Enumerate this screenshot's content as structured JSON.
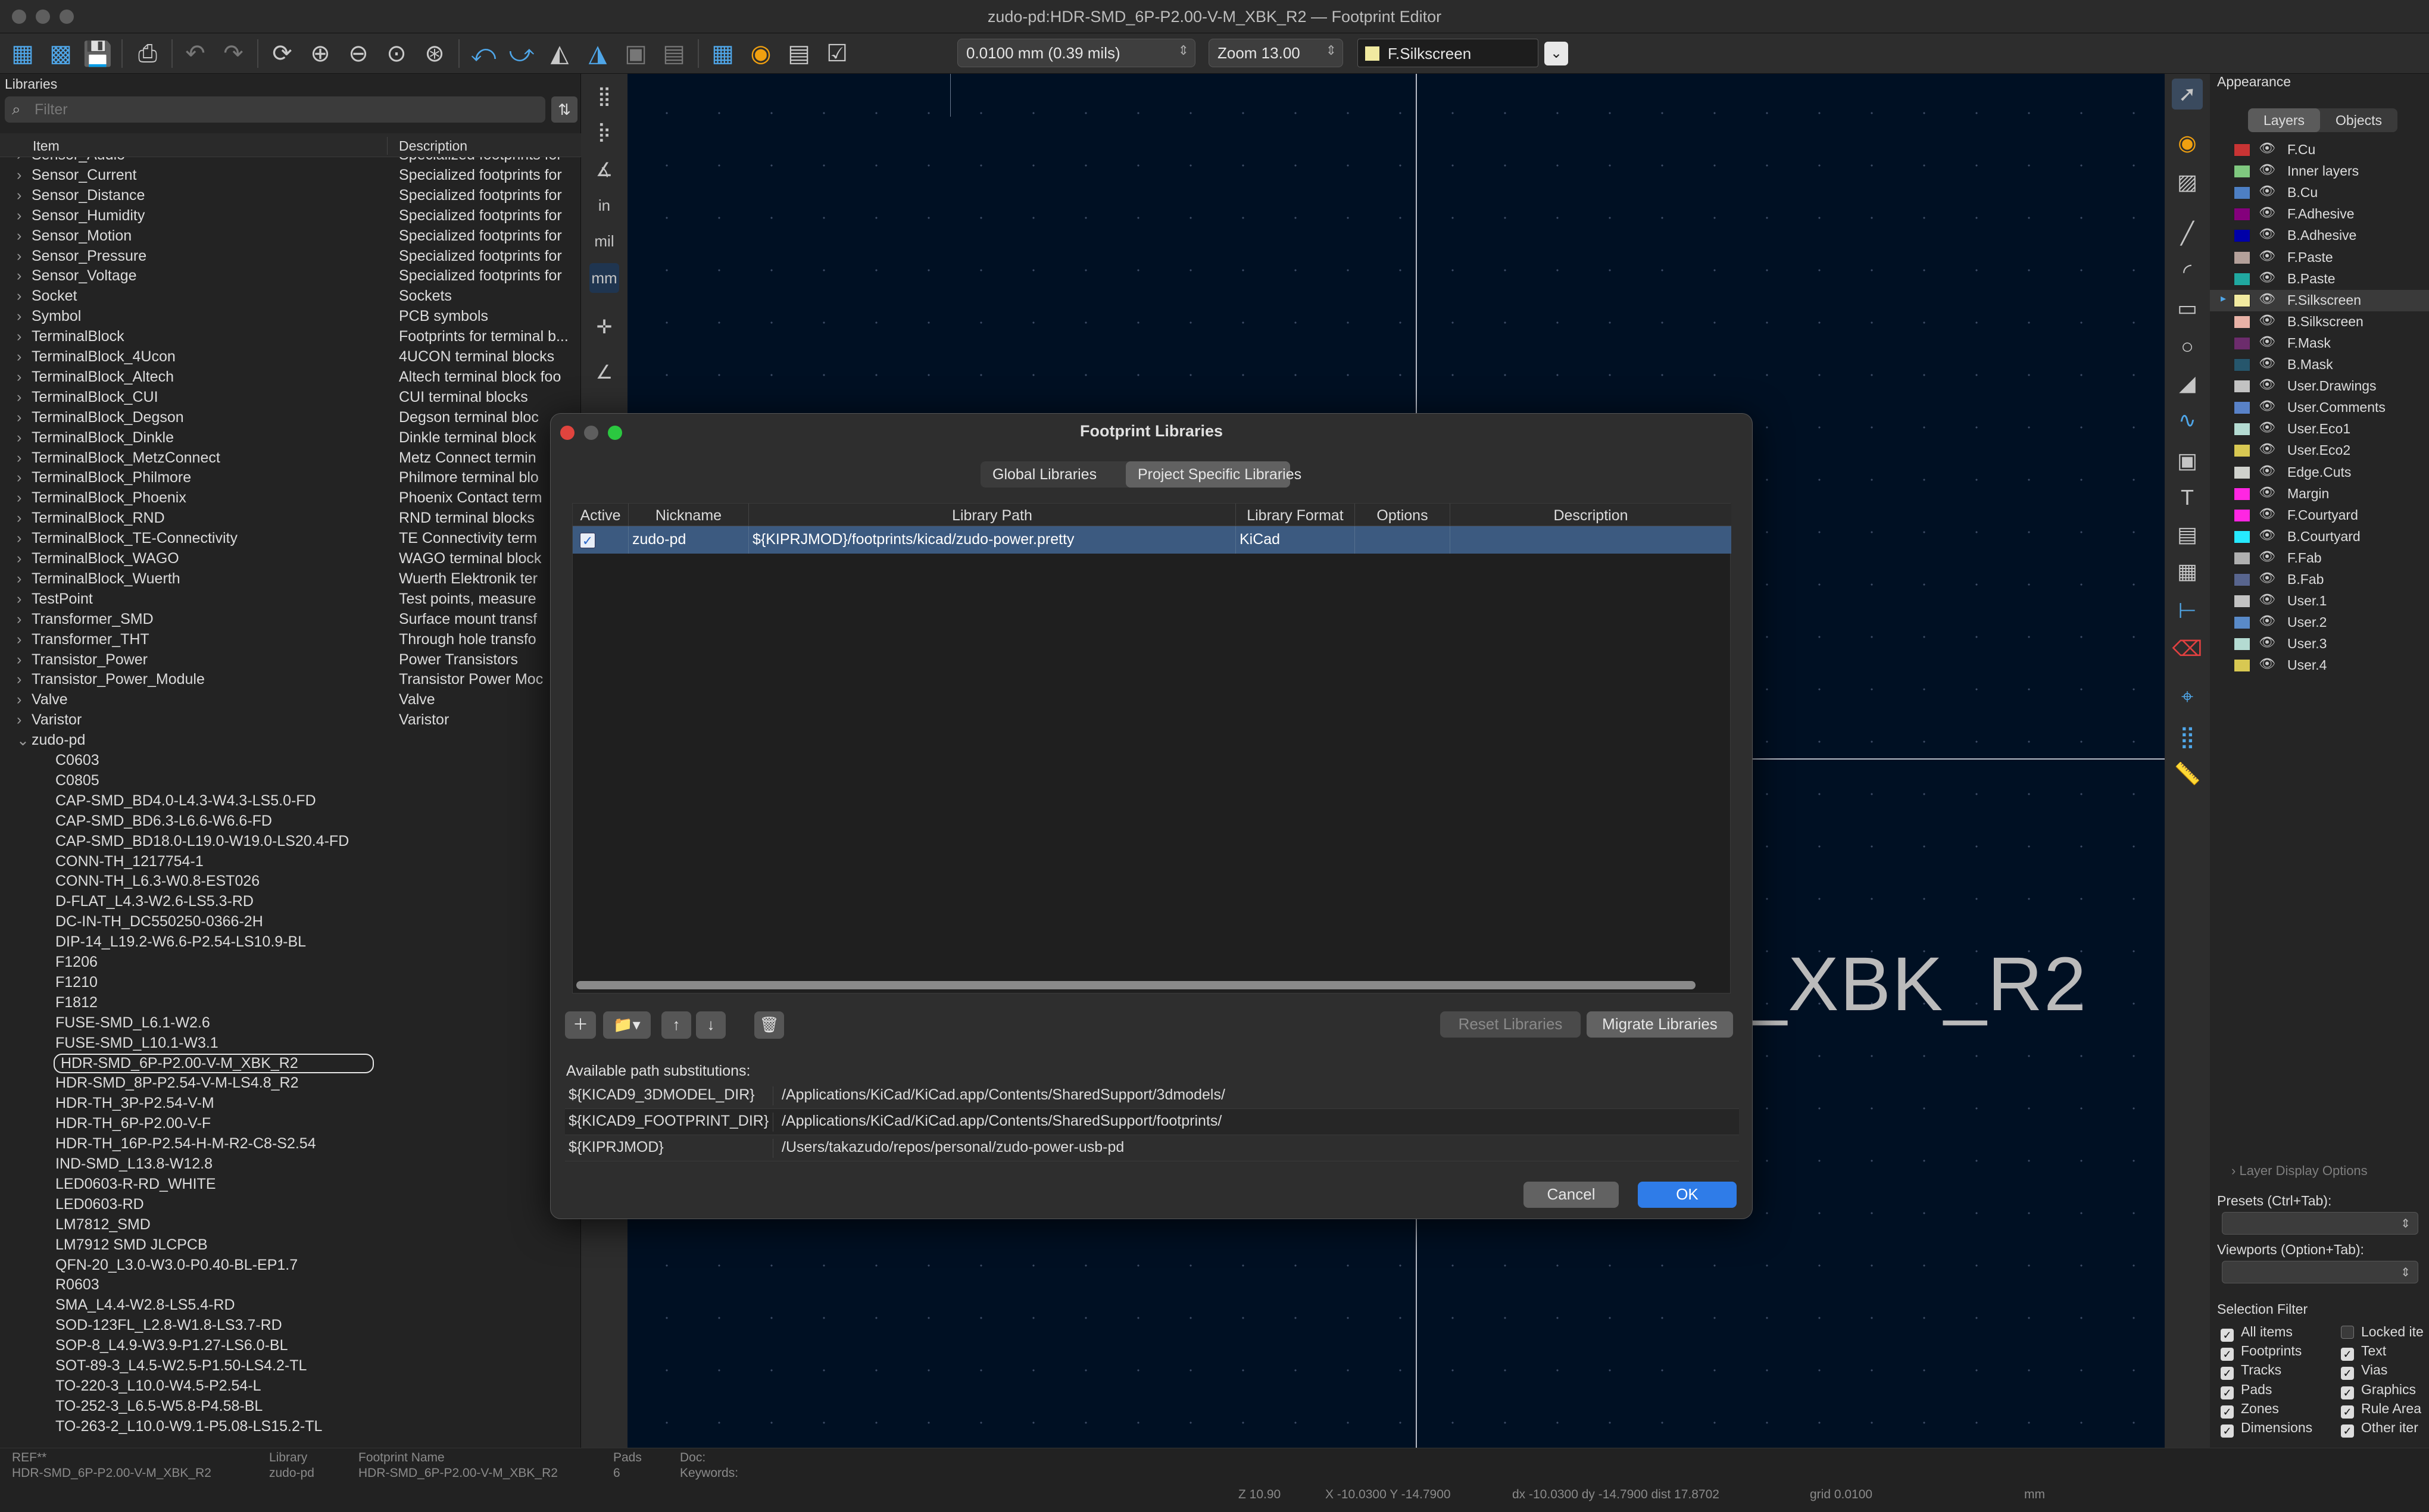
{
  "window": {
    "title": "zudo-pd:HDR-SMD_6P-P2.00-V-M_XBK_R2 — Footprint Editor"
  },
  "toolbar": {
    "grid_select": "0.0100 mm (0.39 mils)",
    "zoom_select": "Zoom 13.00",
    "layer_select": "F.Silkscreen",
    "layer_color": "#f1eaa0"
  },
  "libraries": {
    "header": "Libraries",
    "filter_placeholder": "Filter",
    "col_item": "Item",
    "col_description": "Description",
    "collapsed": [
      {
        "name": "Sensor_Audio",
        "desc": "Specialized footprints for"
      },
      {
        "name": "Sensor_Current",
        "desc": "Specialized footprints for"
      },
      {
        "name": "Sensor_Distance",
        "desc": "Specialized footprints for"
      },
      {
        "name": "Sensor_Humidity",
        "desc": "Specialized footprints for"
      },
      {
        "name": "Sensor_Motion",
        "desc": "Specialized footprints for"
      },
      {
        "name": "Sensor_Pressure",
        "desc": "Specialized footprints for"
      },
      {
        "name": "Sensor_Voltage",
        "desc": "Specialized footprints for"
      },
      {
        "name": "Socket",
        "desc": "Sockets"
      },
      {
        "name": "Symbol",
        "desc": "PCB symbols"
      },
      {
        "name": "TerminalBlock",
        "desc": "Footprints for terminal b..."
      },
      {
        "name": "TerminalBlock_4Ucon",
        "desc": "4UCON terminal blocks"
      },
      {
        "name": "TerminalBlock_Altech",
        "desc": "Altech terminal block foo"
      },
      {
        "name": "TerminalBlock_CUI",
        "desc": "CUI terminal blocks"
      },
      {
        "name": "TerminalBlock_Degson",
        "desc": "Degson terminal bloc"
      },
      {
        "name": "TerminalBlock_Dinkle",
        "desc": "Dinkle terminal block"
      },
      {
        "name": "TerminalBlock_MetzConnect",
        "desc": "Metz Connect termin"
      },
      {
        "name": "TerminalBlock_Philmore",
        "desc": "Philmore terminal blo"
      },
      {
        "name": "TerminalBlock_Phoenix",
        "desc": "Phoenix Contact term"
      },
      {
        "name": "TerminalBlock_RND",
        "desc": "RND terminal blocks"
      },
      {
        "name": "TerminalBlock_TE-Connectivity",
        "desc": "TE Connectivity term"
      },
      {
        "name": "TerminalBlock_WAGO",
        "desc": "WAGO terminal block"
      },
      {
        "name": "TerminalBlock_Wuerth",
        "desc": "Wuerth Elektronik ter"
      },
      {
        "name": "TestPoint",
        "desc": "Test points, measure"
      },
      {
        "name": "Transformer_SMD",
        "desc": "Surface mount transf"
      },
      {
        "name": "Transformer_THT",
        "desc": "Through hole transfo"
      },
      {
        "name": "Transistor_Power",
        "desc": "Power Transistors"
      },
      {
        "name": "Transistor_Power_Module",
        "desc": "Transistor Power Moc"
      },
      {
        "name": "Valve",
        "desc": "Valve"
      },
      {
        "name": "Varistor",
        "desc": "Varistor"
      }
    ],
    "expanded_name": "zudo-pd",
    "footprints": [
      "C0603",
      "C0805",
      "CAP-SMD_BD4.0-L4.3-W4.3-LS5.0-FD",
      "CAP-SMD_BD6.3-L6.6-W6.6-FD",
      "CAP-SMD_BD18.0-L19.0-W19.0-LS20.4-FD",
      "CONN-TH_1217754-1",
      "CONN-TH_L6.3-W0.8-EST026",
      "D-FLAT_L4.3-W2.6-LS5.3-RD",
      "DC-IN-TH_DC550250-0366-2H",
      "DIP-14_L19.2-W6.6-P2.54-LS10.9-BL",
      "F1206",
      "F1210",
      "F1812",
      "FUSE-SMD_L6.1-W2.6",
      "FUSE-SMD_L10.1-W3.1",
      "HDR-SMD_6P-P2.00-V-M_XBK_R2",
      "HDR-SMD_8P-P2.54-V-M-LS4.8_R2",
      "HDR-TH_3P-P2.54-V-M",
      "HDR-TH_6P-P2.00-V-F",
      "HDR-TH_16P-P2.54-H-M-R2-C8-S2.54",
      "IND-SMD_L13.8-W12.8",
      "LED0603-R-RD_WHITE",
      "LED0603-RD",
      "LM7812_SMD",
      "LM7912 SMD JLCPCB",
      "QFN-20_L3.0-W3.0-P0.40-BL-EP1.7",
      "R0603",
      "SMA_L4.4-W2.8-LS5.4-RD",
      "SOD-123FL_L2.8-W1.8-LS3.7-RD",
      "SOP-8_L4.9-W3.9-P1.27-LS6.0-BL",
      "SOT-89-3_L4.5-W2.5-P1.50-LS4.2-TL",
      "TO-220-3_L10.0-W4.5-P2.54-L",
      "TO-252-3_L6.5-W5.8-P4.58-BL",
      "TO-263-2_L10.0-W9.1-P5.08-LS15.2-TL"
    ],
    "selected_footprint": "HDR-SMD_6P-P2.00-V-M_XBK_R2"
  },
  "canvas": {
    "footprint_text": "_XBK_R2"
  },
  "dialog": {
    "title": "Footprint Libraries",
    "tab_global": "Global Libraries",
    "tab_project": "Project Specific Libraries",
    "columns": [
      "Active",
      "Nickname",
      "Library Path",
      "Library Format",
      "Options",
      "Description"
    ],
    "row": {
      "active": true,
      "nickname": "zudo-pd",
      "path": "${KIPRJMOD}/footprints/kicad/zudo-power.pretty",
      "format": "KiCad",
      "options": "",
      "description": ""
    },
    "reset_label": "Reset Libraries",
    "migrate_label": "Migrate Libraries",
    "path_sub_title": "Available path substitutions:",
    "path_subs": [
      {
        "key": "${KICAD9_3DMODEL_DIR}",
        "value": "/Applications/KiCad/KiCad.app/Contents/SharedSupport/3dmodels/"
      },
      {
        "key": "${KICAD9_FOOTPRINT_DIR}",
        "value": "/Applications/KiCad/KiCad.app/Contents/SharedSupport/footprints/"
      },
      {
        "key": "${KIPRJMOD}",
        "value": "/Users/takazudo/repos/personal/zudo-power-usb-pd"
      }
    ],
    "cancel_label": "Cancel",
    "ok_label": "OK"
  },
  "appearance": {
    "title": "Appearance",
    "tab_layers": "Layers",
    "tab_objects": "Objects",
    "layers": [
      {
        "name": "F.Cu",
        "color": "#c83434"
      },
      {
        "name": "Inner layers",
        "color": "#7fc87f"
      },
      {
        "name": "B.Cu",
        "color": "#4d7fc4"
      },
      {
        "name": "F.Adhesive",
        "color": "#84007c"
      },
      {
        "name": "B.Adhesive",
        "color": "#0000a8"
      },
      {
        "name": "F.Paste",
        "color": "#b4a09a"
      },
      {
        "name": "B.Paste",
        "color": "#20a8a0"
      },
      {
        "name": "F.Silkscreen",
        "color": "#f1eaa0"
      },
      {
        "name": "B.Silkscreen",
        "color": "#e8b2a7"
      },
      {
        "name": "F.Mask",
        "color": "#6c2c6c"
      },
      {
        "name": "B.Mask",
        "color": "#26566c"
      },
      {
        "name": "User.Drawings",
        "color": "#c2c2c2"
      },
      {
        "name": "User.Comments",
        "color": "#5982c8"
      },
      {
        "name": "User.Eco1",
        "color": "#b4dbd2"
      },
      {
        "name": "User.Eco2",
        "color": "#d8c852"
      },
      {
        "name": "Edge.Cuts",
        "color": "#d0d2cd"
      },
      {
        "name": "Margin",
        "color": "#ff26e2"
      },
      {
        "name": "F.Courtyard",
        "color": "#ff26e2"
      },
      {
        "name": "B.Courtyard",
        "color": "#26e9ff"
      },
      {
        "name": "F.Fab",
        "color": "#afafaf"
      },
      {
        "name": "B.Fab",
        "color": "#58658e"
      },
      {
        "name": "User.1",
        "color": "#c2c2c2"
      },
      {
        "name": "User.2",
        "color": "#598ac8"
      },
      {
        "name": "User.3",
        "color": "#b4dbd2"
      },
      {
        "name": "User.4",
        "color": "#d8c852"
      }
    ],
    "selected_layer": "F.Silkscreen",
    "layer_display_options": "Layer Display Options",
    "presets_label": "Presets (Ctrl+Tab):",
    "viewports_label": "Viewports (Option+Tab):",
    "selection_filter_title": "Selection Filter",
    "filters_left": [
      {
        "label": "All items",
        "checked": true
      },
      {
        "label": "Footprints",
        "checked": true
      },
      {
        "label": "Tracks",
        "checked": true
      },
      {
        "label": "Pads",
        "checked": true
      },
      {
        "label": "Zones",
        "checked": true
      },
      {
        "label": "Dimensions",
        "checked": true
      }
    ],
    "filters_right": [
      {
        "label": "Locked ite",
        "checked": false
      },
      {
        "label": "Text",
        "checked": true
      },
      {
        "label": "Vias",
        "checked": true
      },
      {
        "label": "Graphics",
        "checked": true
      },
      {
        "label": "Rule Area",
        "checked": true
      },
      {
        "label": "Other iter",
        "checked": true
      }
    ]
  },
  "statusbar": {
    "ref_label": "REF**",
    "ref_value": "HDR-SMD_6P-P2.00-V-M_XBK_R2",
    "library_label": "Library",
    "library_value": "zudo-pd",
    "fp_name_label": "Footprint Name",
    "fp_name_value": "HDR-SMD_6P-P2.00-V-M_XBK_R2",
    "pads_label": "Pads",
    "pads_value": "6",
    "doc_label": "Doc:",
    "keywords_label": "Keywords:",
    "zoom": "Z 10.90",
    "xy": "X -10.0300  Y -14.7900",
    "dxy": "dx -10.0300  dy -14.7900  dist 17.8702",
    "grid": "grid 0.0100",
    "units": "mm"
  }
}
